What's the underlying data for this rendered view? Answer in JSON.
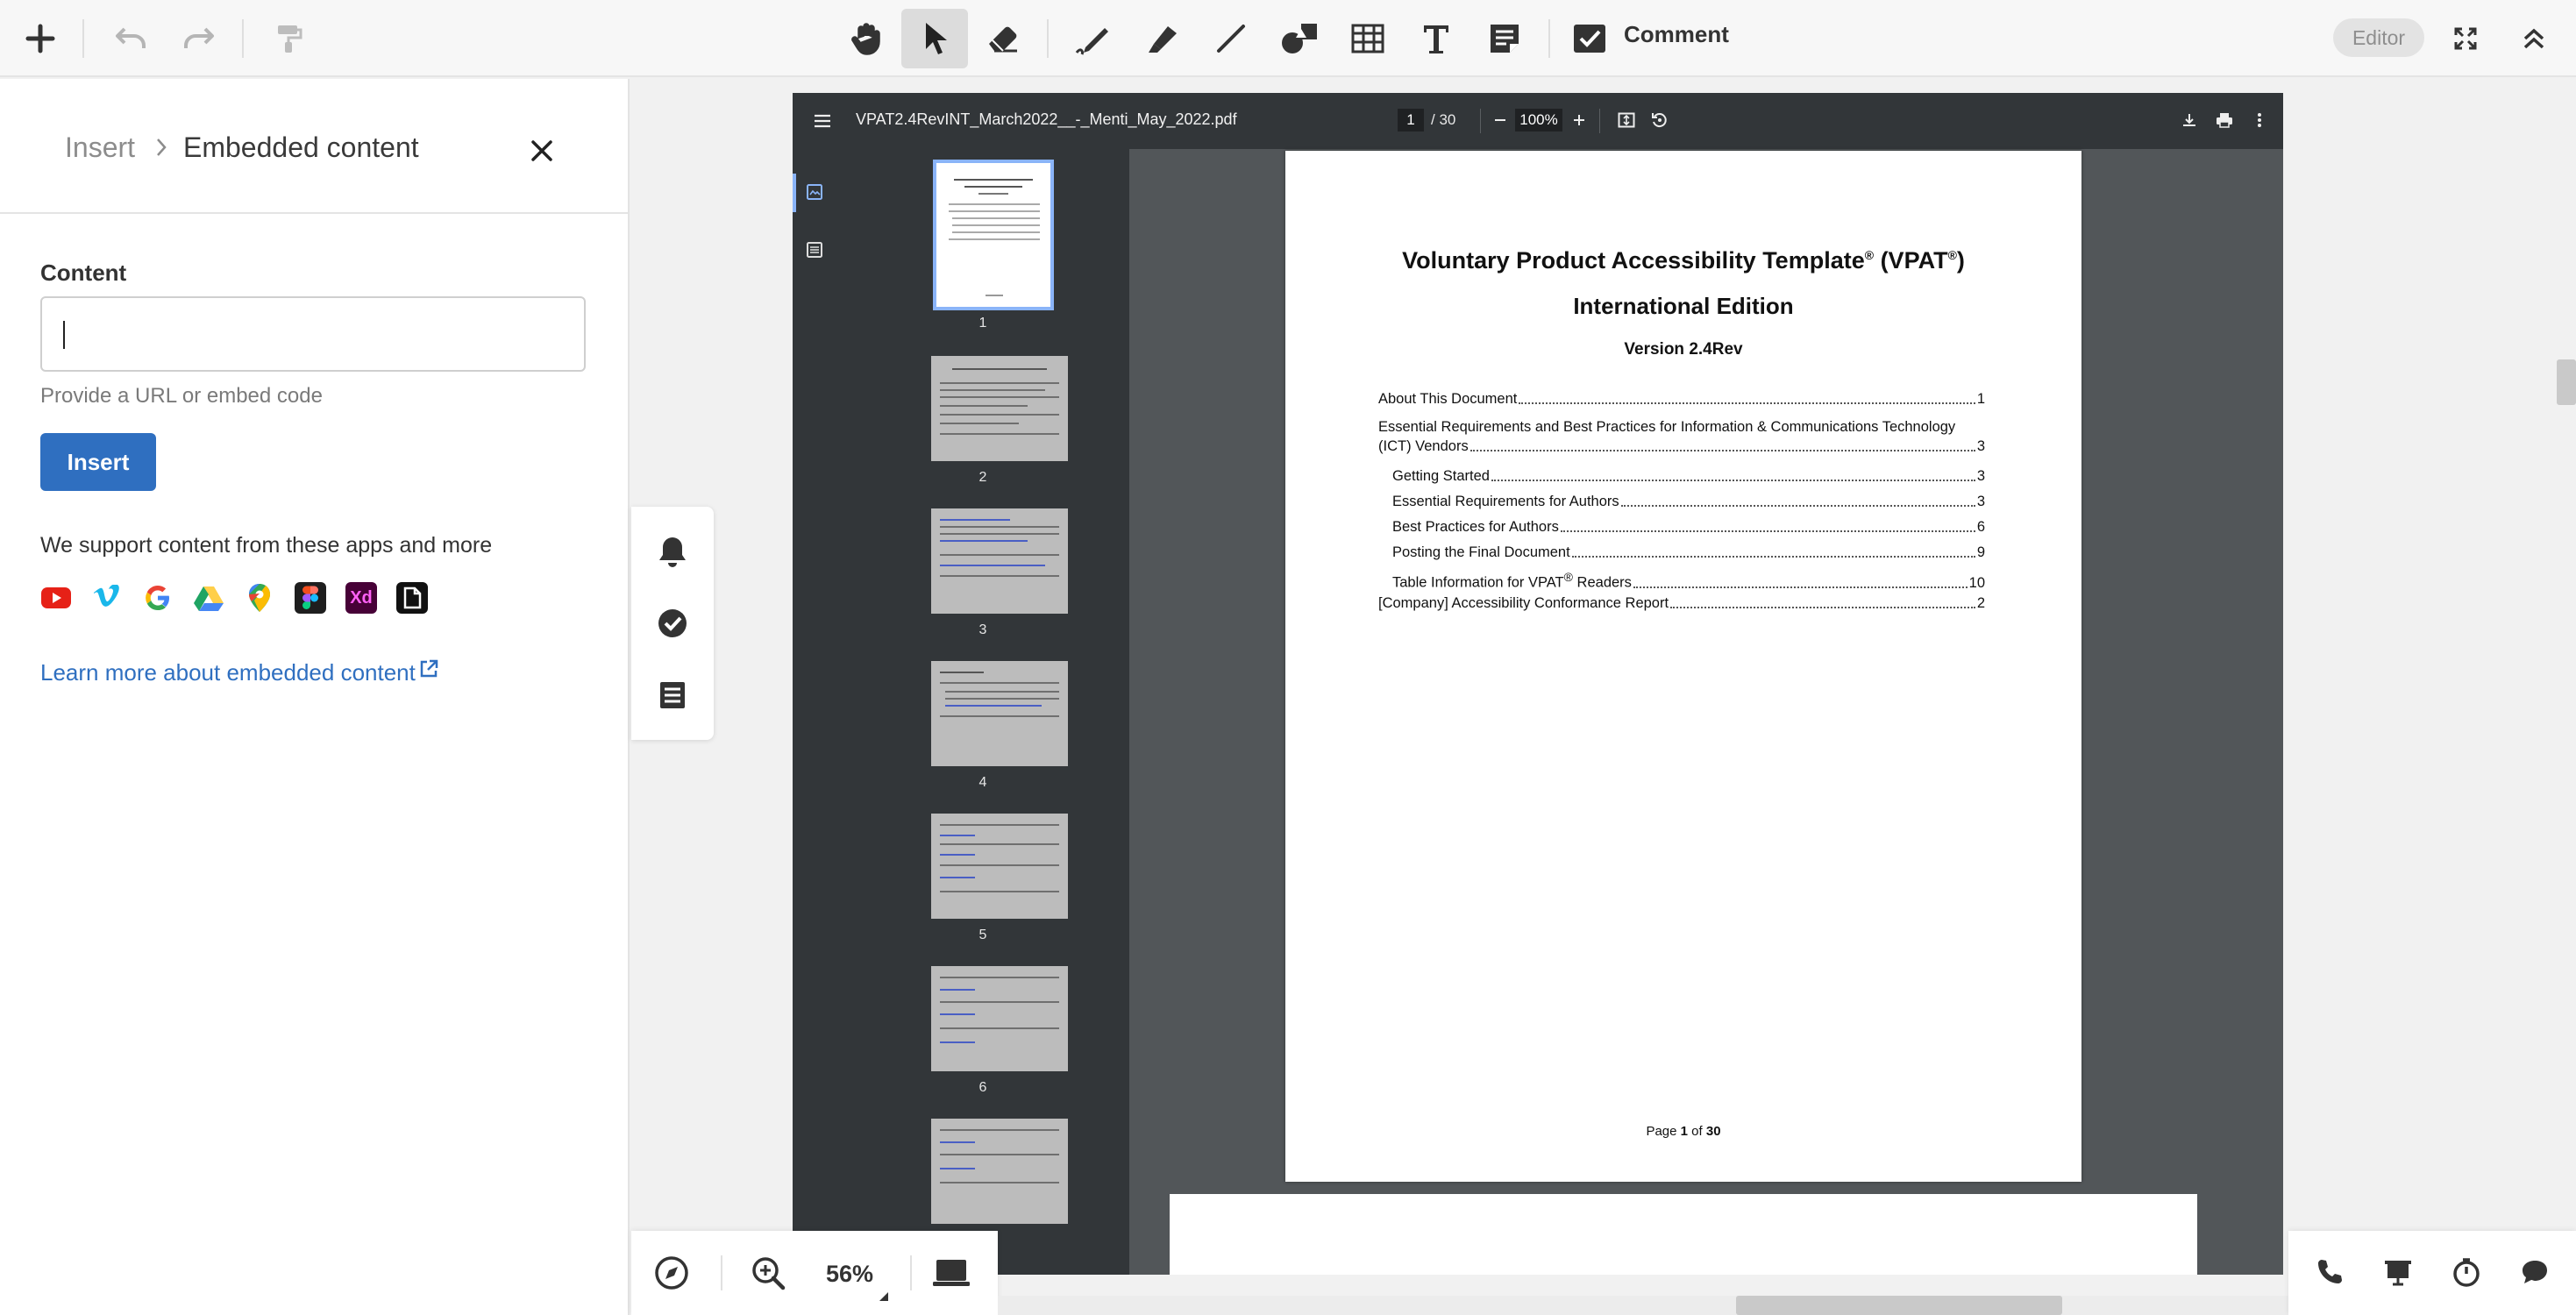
{
  "toolbar": {
    "comment_label": "Comment",
    "editor_badge": "Editor"
  },
  "panel": {
    "breadcrumb_parent": "Insert",
    "breadcrumb_current": "Embedded content",
    "content_label": "Content",
    "content_value": "",
    "content_help": "Provide a URL or embed code",
    "insert_button": "Insert",
    "support_text": "We support content from these apps and more",
    "supported_apps": [
      "youtube-icon",
      "vimeo-icon",
      "google-icon",
      "google-drive-icon",
      "google-maps-icon",
      "figma-icon",
      "adobe-xd-icon",
      "file-icon"
    ],
    "xd_label": "Xd",
    "learn_more": "Learn more about embedded content",
    "accent_color": "#2f6fc0"
  },
  "zoom": {
    "value": "56%"
  },
  "viewer": {
    "file_name": "VPAT2.4RevINT_March2022__-_Menti_May_2022.pdf",
    "current_page": "1",
    "page_total": "/ 30",
    "zoom": "100%",
    "thumbnail_numbers": [
      "1",
      "2",
      "3",
      "4",
      "5",
      "6"
    ]
  },
  "document": {
    "title": "Voluntary Product Accessibility Template",
    "title_reg": "®",
    "title_abbr": " (VPAT",
    "title_close": ")",
    "subtitle": "International Edition",
    "version": "Version 2.4Rev",
    "toc": [
      {
        "label": "About This Document",
        "page": "1"
      },
      {
        "label": "Essential Requirements and Best Practices for Information & Communications Technology",
        "continuation": "(ICT) Vendors",
        "page": "3"
      },
      {
        "label": "Getting Started",
        "page": "3"
      },
      {
        "label": "Essential Requirements for Authors",
        "page": "3"
      },
      {
        "label": "Best Practices for Authors",
        "page": "6"
      },
      {
        "label": "Posting the Final Document",
        "page": "9"
      },
      {
        "label": "Table Information for VPAT",
        "label_sup": "®",
        "label_end": " Readers",
        "page": "10"
      },
      {
        "label": "[Company] Accessibility Conformance Report",
        "page": "2"
      }
    ],
    "footer_prefix": "Page ",
    "footer_page": "1",
    "footer_mid": " of ",
    "footer_total": "30"
  }
}
